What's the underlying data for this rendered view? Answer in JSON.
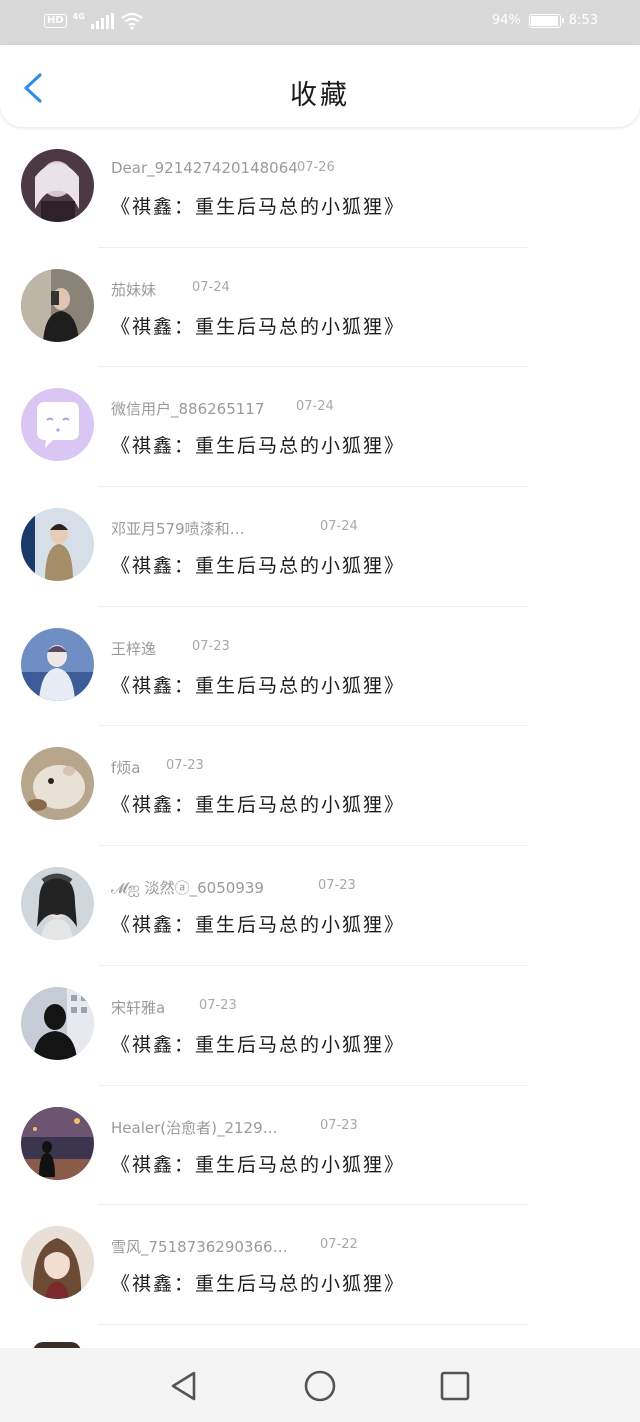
{
  "status_bar": {
    "hd": "HD",
    "network": "4G",
    "battery": "94%",
    "time": "8:53"
  },
  "header": {
    "title": "收藏",
    "back_icon": "chevron-left-icon",
    "accent_color": "#2f8fe6"
  },
  "favorites": [
    {
      "user": "Dear_921427420148064",
      "date": "07-26",
      "story": "《祺鑫：重生后马总的小狐狸》"
    },
    {
      "user": "茄妹妹",
      "date": "07-24",
      "story": "《祺鑫：重生后马总的小狐狸》"
    },
    {
      "user": "微信用户_886265117",
      "date": "07-24",
      "story": "《祺鑫：重生后马总的小狐狸》"
    },
    {
      "user": "邓亚月579喷漆和…",
      "date": "07-24",
      "story": "《祺鑫：重生后马总的小狐狸》"
    },
    {
      "user": "王梓逸",
      "date": "07-23",
      "story": "《祺鑫：重生后马总的小狐狸》"
    },
    {
      "user": "f烦a",
      "date": "07-23",
      "story": "《祺鑫：重生后马总的小狐狸》"
    },
    {
      "user": "𝓜ஐ 淡然ⓐ_6050939",
      "date": "07-23",
      "story": "《祺鑫：重生后马总的小狐狸》"
    },
    {
      "user": "宋轩雅a",
      "date": "07-23",
      "story": "《祺鑫：重生后马总的小狐狸》"
    },
    {
      "user": "Healer(治愈者)_2129…",
      "date": "07-23",
      "story": "《祺鑫：重生后马总的小狐狸》"
    },
    {
      "user": "雪风_7518736290366…",
      "date": "07-22",
      "story": "《祺鑫：重生后马总的小狐狸》"
    }
  ],
  "system_nav": {
    "back": "triangle-back-icon",
    "home": "circle-home-icon",
    "recents": "square-recents-icon"
  }
}
